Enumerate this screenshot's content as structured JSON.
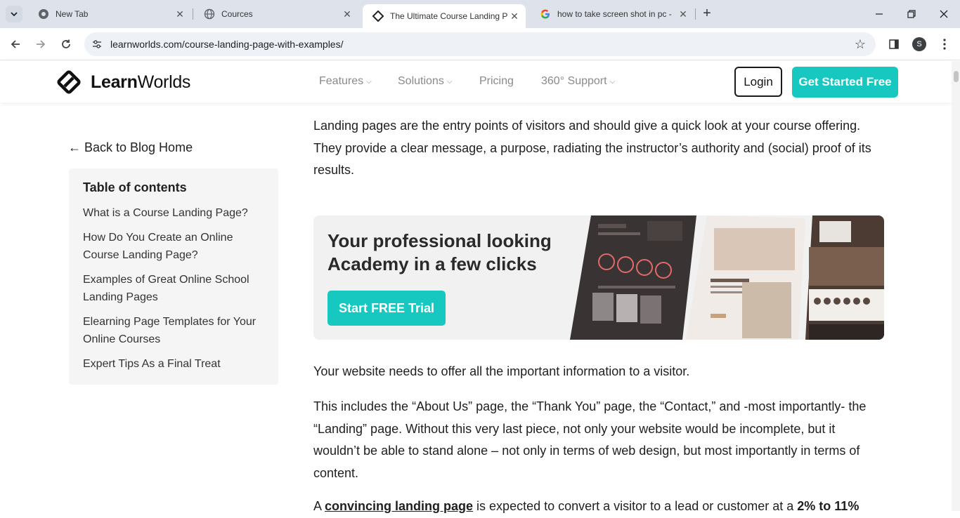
{
  "browser": {
    "tabs": [
      {
        "title": "New Tab",
        "icon": "chrome-icon"
      },
      {
        "title": "Cources",
        "icon": "globe-icon"
      },
      {
        "title": "The Ultimate Course Landing Page",
        "icon": "learnworlds-icon",
        "active": true
      },
      {
        "title": "how to take screen shot in pc -",
        "icon": "google-icon"
      }
    ],
    "url": "learnworlds.com/course-landing-page-with-examples/",
    "profile_initial": "S"
  },
  "site": {
    "logo": {
      "bold": "Learn",
      "light": "Worlds"
    },
    "nav": [
      {
        "label": "Features",
        "has_dropdown": true
      },
      {
        "label": "Solutions",
        "has_dropdown": true
      },
      {
        "label": "Pricing",
        "has_dropdown": false
      },
      {
        "label": "360° Support",
        "has_dropdown": true
      }
    ],
    "login_label": "Login",
    "cta_label": "Get Started Free",
    "accent_color": "#17c8c0"
  },
  "sidebar": {
    "back_link": "← Back to Blog Home",
    "toc_title": "Table of contents",
    "toc_items": [
      "What is a Course Landing Page?",
      "How Do You Create an Online Course Landing Page?",
      "Examples of Great Online School Landing Pages",
      "Elearning Page Templates for Your Online Courses",
      "Expert Tips As a Final Treat"
    ]
  },
  "article": {
    "intro": "Landing pages are the entry points of visitors and should give a quick look at your course offering. They provide a clear message, a purpose, radiating the instructor’s authority and (social) proof of its results.",
    "banner": {
      "headline": "Your professional looking Academy in a few clicks",
      "button": "Start FREE Trial"
    },
    "p2": "Your website needs to offer all the important information to a visitor.",
    "p3": "This includes the “About Us” page, the “Thank You” page, the “Contact,” and -most importantly- the “Landing” page. Without this very last piece, not only your website would be incomplete, but it wouldn’t be able to stand alone – not only in terms of web design, but most importantly in terms of content.",
    "p4": {
      "pre": "A ",
      "bold1": "convincing landing page",
      "mid": " is expected to convert a visitor to a lead or customer at a ",
      "bold2": "2% to 11%"
    }
  }
}
